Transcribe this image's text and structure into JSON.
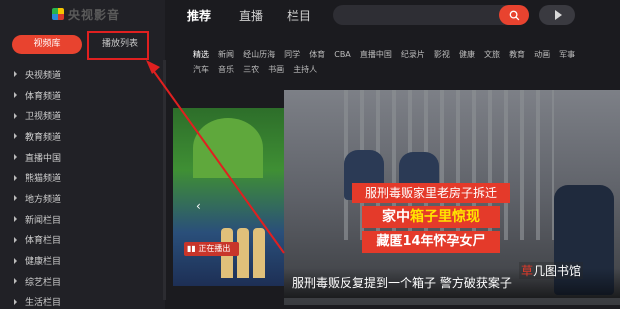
{
  "app": {
    "logo": "央视影音"
  },
  "sidebar": {
    "tabs": [
      {
        "label": "视频库",
        "active": true
      },
      {
        "label": "播放列表",
        "active": false
      }
    ],
    "channels": [
      "央视频道",
      "体育频道",
      "卫视频道",
      "教育频道",
      "直播中国",
      "熊猫频道",
      "地方频道",
      "新闻栏目",
      "体育栏目",
      "健康栏目",
      "综艺栏目",
      "生活栏目"
    ]
  },
  "topnav": {
    "items": [
      {
        "label": "推荐",
        "active": true
      },
      {
        "label": "直播",
        "active": false
      },
      {
        "label": "栏目",
        "active": false
      }
    ],
    "search_placeholder": ""
  },
  "categories": [
    "精选",
    "新闻",
    "经山历海",
    "同学",
    "体育",
    "CBA",
    "直播中国",
    "纪录片",
    "影视",
    "健康",
    "文旅",
    "教育",
    "动画",
    "军事",
    "汽车",
    "音乐",
    "三农",
    "书画",
    "主持人"
  ],
  "stage": {
    "live_label": "正在播出"
  },
  "card": {
    "banner_line1": "服刑毒贩家里老房子拆迁",
    "banner_line2_a": "家中",
    "banner_line2_b": "箱子里惊现",
    "banner_line3": "藏匿14年怀孕女尸",
    "caption": "服刑毒贩反复提到一个箱子 警方破获案子",
    "watermark_a": "草",
    "watermark_b": "几图书馆"
  },
  "colors": {
    "accent": "#e8432f",
    "highlight": "#e02020",
    "background": "#1b1b1f"
  }
}
